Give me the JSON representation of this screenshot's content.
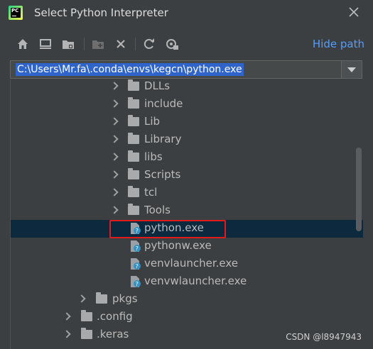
{
  "window": {
    "title": "Select Python Interpreter",
    "icon": "pycharm-logo",
    "logo_text": "PC"
  },
  "toolbar": {
    "buttons": [
      "home-icon",
      "desktop-icon",
      "project-folder-icon",
      "new-folder-icon",
      "delete-icon",
      "refresh-icon",
      "show-hidden-icon"
    ],
    "hide_path_label": "Hide path"
  },
  "path_field": {
    "value": "C:\\Users\\Mr.fa\\.conda\\envs\\kegcn\\python.exe"
  },
  "tree": {
    "items": [
      {
        "label": "DLLs",
        "type": "folder",
        "expandable": true
      },
      {
        "label": "include",
        "type": "folder",
        "expandable": true
      },
      {
        "label": "Lib",
        "type": "folder",
        "expandable": true
      },
      {
        "label": "Library",
        "type": "folder",
        "expandable": true
      },
      {
        "label": "libs",
        "type": "folder",
        "expandable": true
      },
      {
        "label": "Scripts",
        "type": "folder",
        "expandable": true
      },
      {
        "label": "tcl",
        "type": "folder",
        "expandable": true
      },
      {
        "label": "Tools",
        "type": "folder",
        "expandable": true
      },
      {
        "label": "python.exe",
        "type": "python-file",
        "selected": true
      },
      {
        "label": "pythonw.exe",
        "type": "python-file"
      },
      {
        "label": "venvlauncher.exe",
        "type": "python-file"
      },
      {
        "label": "venvwlauncher.exe",
        "type": "python-file"
      },
      {
        "label": "pkgs",
        "type": "folder",
        "expandable": true
      },
      {
        "label": ".config",
        "type": "folder",
        "expandable": true
      },
      {
        "label": ".keras",
        "type": "folder",
        "expandable": true
      }
    ]
  },
  "watermark": "CSDN @l8947943",
  "colors": {
    "background": "#3c3f41",
    "selection": "#0d293e",
    "path_highlight": "#2f65ca",
    "link": "#589df6",
    "annotation_box": "#e11b1b"
  }
}
